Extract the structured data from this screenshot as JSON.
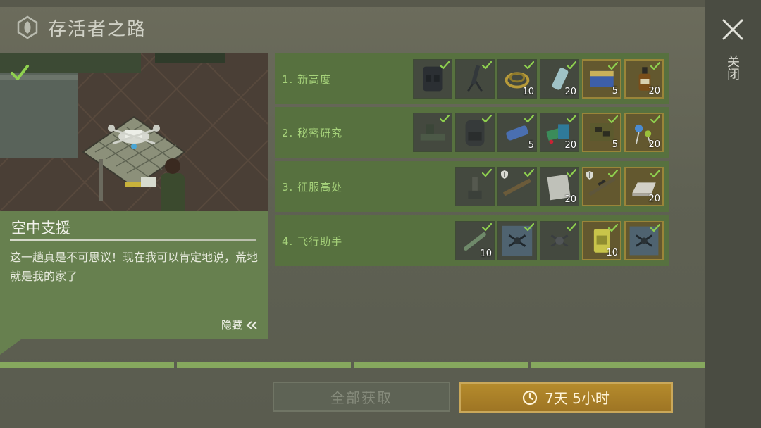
{
  "header": {
    "title": "存活者之路",
    "logo_icon": "emblem-icon"
  },
  "close": {
    "label": "关闭",
    "icon": "close-icon"
  },
  "story": {
    "title": "空中支援",
    "text": "这一趟真是不可思议！现在我可以肯定地说，荒地就是我的家了",
    "hide_label": "隐藏",
    "completed": true
  },
  "stages": [
    {
      "label": "1. 新高度",
      "items": [
        {
          "icon": "tactical-vest-icon",
          "qty": "",
          "gold": false,
          "checked": true
        },
        {
          "icon": "mortar-icon",
          "qty": "",
          "gold": false,
          "checked": true
        },
        {
          "icon": "wire-coil-icon",
          "qty": "10",
          "gold": false,
          "checked": true
        },
        {
          "icon": "spray-can-icon",
          "qty": "20",
          "gold": false,
          "checked": true
        },
        {
          "icon": "battery-icon",
          "qty": "5",
          "gold": true,
          "checked": true
        },
        {
          "icon": "bottle-icon",
          "qty": "20",
          "gold": true,
          "checked": true
        }
      ]
    },
    {
      "label": "2. 秘密研究",
      "items": [
        {
          "icon": "workbench-icon",
          "qty": "",
          "gold": false,
          "checked": true
        },
        {
          "icon": "backpack-icon",
          "qty": "",
          "gold": false,
          "checked": true
        },
        {
          "icon": "circuit-scrap-icon",
          "qty": "5",
          "gold": false,
          "checked": true
        },
        {
          "icon": "book-pile-icon",
          "qty": "20",
          "gold": false,
          "checked": true
        },
        {
          "icon": "circuit-board-icon",
          "qty": "5",
          "gold": true,
          "checked": true
        },
        {
          "icon": "electronic-parts-icon",
          "qty": "20",
          "gold": true,
          "checked": true
        }
      ]
    },
    {
      "label": "3. 征服高处",
      "items": [
        {
          "icon": "turret-icon",
          "qty": "",
          "gold": false,
          "checked": true,
          "shield": false
        },
        {
          "icon": "rifle-icon",
          "qty": "",
          "gold": false,
          "checked": true,
          "shield": true
        },
        {
          "icon": "cloth-icon",
          "qty": "20",
          "gold": false,
          "checked": true,
          "shield": false
        },
        {
          "icon": "sniper-rifle-icon",
          "qty": "",
          "gold": true,
          "checked": true,
          "shield": true
        },
        {
          "icon": "metal-ingot-icon",
          "qty": "20",
          "gold": true,
          "checked": true,
          "shield": false
        }
      ]
    },
    {
      "label": "4. 飞行助手",
      "items": [
        {
          "icon": "rocket-icon",
          "qty": "10",
          "gold": false,
          "checked": true
        },
        {
          "icon": "drone-blueprint-icon",
          "qty": "",
          "gold": false,
          "checked": true
        },
        {
          "icon": "drone-icon",
          "qty": "",
          "gold": false,
          "checked": true
        },
        {
          "icon": "fuel-can-icon",
          "qty": "10",
          "gold": true,
          "checked": true
        },
        {
          "icon": "drone-blueprint-icon",
          "qty": "",
          "gold": true,
          "checked": true
        }
      ]
    }
  ],
  "progress": {
    "segments": 4,
    "completed": 4
  },
  "buttons": {
    "claim_all": "全部获取",
    "timer": "7天 5小时",
    "timer_icon": "clock-icon"
  },
  "colors": {
    "accent_green": "#a6d27a",
    "panel_green": "#67804f",
    "gold": "#caa85a"
  }
}
